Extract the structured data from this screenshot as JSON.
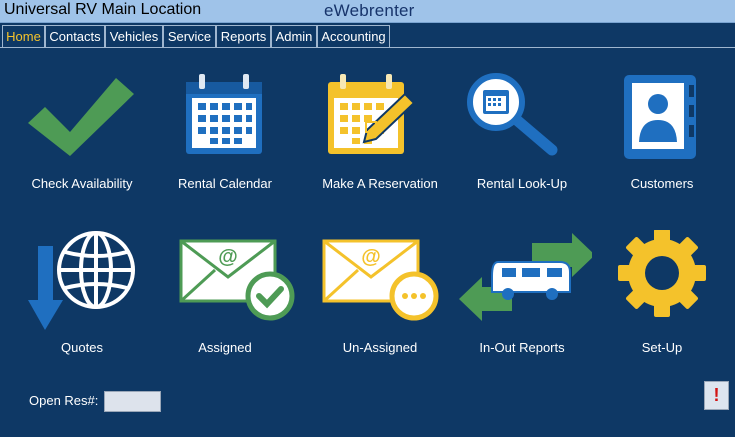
{
  "window": {
    "title": "Universal RV Main Location",
    "brand": "eWebrenter"
  },
  "menu": {
    "tabs": [
      {
        "label": "Home",
        "active": true
      },
      {
        "label": "Contacts"
      },
      {
        "label": "Vehicles"
      },
      {
        "label": "Service"
      },
      {
        "label": "Reports"
      },
      {
        "label": "Admin"
      },
      {
        "label": "Accounting"
      }
    ]
  },
  "tiles": [
    {
      "label": "Check Availability",
      "icon": "checkmark-icon"
    },
    {
      "label": "Rental Calendar",
      "icon": "calendar-icon"
    },
    {
      "label": "Make A Reservation",
      "icon": "calendar-edit-icon"
    },
    {
      "label": "Rental Look-Up",
      "icon": "search-calendar-icon"
    },
    {
      "label": "Customers",
      "icon": "contact-book-icon"
    },
    {
      "label": "Quotes",
      "icon": "globe-download-icon"
    },
    {
      "label": "Assigned",
      "icon": "email-check-icon"
    },
    {
      "label": "Un-Assigned",
      "icon": "email-pending-icon"
    },
    {
      "label": "In-Out Reports",
      "icon": "rv-exchange-icon"
    },
    {
      "label": "Set-Up",
      "icon": "gear-icon"
    }
  ],
  "footer": {
    "open_res_label": "Open Res#:",
    "open_res_value": "",
    "alert_label": "!"
  },
  "colors": {
    "background": "#0e3865",
    "titlebar": "#9fc3e9",
    "green": "#4e9b55",
    "blue": "#1f6fc0",
    "yellow": "#f4c22b"
  }
}
